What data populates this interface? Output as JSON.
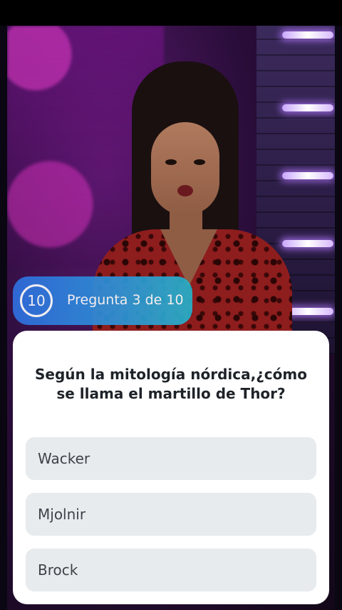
{
  "quiz": {
    "timer_value": "10",
    "counter_label": "Pregunta 3 de 10",
    "question": "Según la mitología nórdica,¿cómo se llama el martillo de Thor?",
    "answers": [
      {
        "label": "Wacker"
      },
      {
        "label": "Mjolnir"
      },
      {
        "label": "Brock"
      }
    ]
  },
  "colors": {
    "pill_gradient_start": "#2f6fe0",
    "pill_gradient_end": "#28b2c9",
    "card_background": "#ffffff",
    "answer_background": "#e7ebee",
    "question_text": "#1e2329",
    "answer_text": "#3d4349"
  }
}
